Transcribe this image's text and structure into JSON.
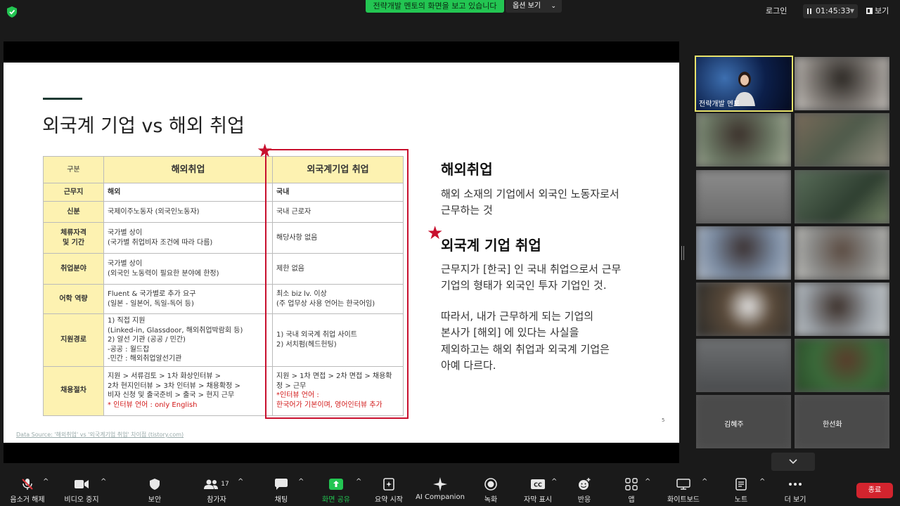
{
  "topbar": {
    "share_banner": "전략개발 멘토의 화면을 보고 있습니다",
    "view_options": "옵션 보기",
    "login": "로그인",
    "timer": "01:45:33",
    "view": "보기"
  },
  "slide": {
    "title": "외국계 기업 vs 해외 취업",
    "table": {
      "headers": [
        "구분",
        "해외취업",
        "외국계기업 취업"
      ],
      "rows": [
        {
          "cat": "근무지",
          "a": "해외",
          "b": "국내"
        },
        {
          "cat": "신분",
          "a": "국제이주노동자 (외국인노동자)",
          "b": "국내 근로자"
        },
        {
          "cat": "체류자격\n및 기간",
          "a": "국가별 상이\n(국가별 취업비자 조건에 따라 다름)",
          "b": "해당사항 없음"
        },
        {
          "cat": "취업분야",
          "a": "국가별 상이\n(외국인 노동력이 필요한 분야에 한정)",
          "b": "제한 없음"
        },
        {
          "cat": "어학 역량",
          "a": "Fluent & 국가별로 추가 요구\n(일본 - 일본어, 독일-독어 등)",
          "b": "최소 biz lv. 이상\n(주 업무상 사용 언어는 한국어임)"
        },
        {
          "cat": "지원경로",
          "a": "1) 직접 지원\n(Linked-in, Glassdoor, 해외취업박람회 등)\n2) 알선 기관 (공공 / 민간)\n-공공 : 월드잡\n-민간 : 해외취업알선기관",
          "b": "1) 국내 외국계 취업 사이트\n2) 서치펌(헤드헌팅)"
        },
        {
          "cat": "채용절차",
          "a": "지원 > 서류검토 > 1차 화상인터뷰 >\n2차 현지인터뷰 > 3차 인터뷰 > 채용확정 >\n비자 신청 및 출국준비 > 출국 > 현지 근무",
          "a_note": "* 인터뷰 언어 : only English",
          "b": "지원 > 1차 면접 > 2차 면접 > 채용확\n정 > 근무",
          "b_note": "*인터뷰 언어 :\n한국어가 기본이며, 영어인터뷰 추가"
        }
      ]
    },
    "sec1_title": "해외취업",
    "sec1_body": "해외 소재의 기업에서 외국인 노동자로서\n근무하는 것",
    "sec2_title": "외국계 기업 취업",
    "sec2_body": "근무지가 [한국] 인 국내 취업으로서 근무\n기업의 형태가 외국인 투자 기업인 것.",
    "sec3_body": "따라서, 내가 근무하게 되는 기업의\n본사가 [해외] 에 있다는 사실을\n제외하고는 해외 취업과 외국계 기업은\n아예 다르다.",
    "source": "Data Source: '해외취업' vs '외국계기업 취업' 차이점 (tistory.com)",
    "page_number": "5"
  },
  "participants": {
    "host_name": "전략개발 멘토",
    "others": [
      "",
      "",
      "",
      "",
      "",
      "",
      "",
      "",
      "",
      "",
      "",
      "",
      "김혜주",
      "한선화"
    ]
  },
  "toolbar": {
    "items": [
      {
        "label": "음소거 해제",
        "icon": "mic-off-icon"
      },
      {
        "label": "비디오 중지",
        "icon": "video-icon"
      },
      {
        "label": "보안",
        "icon": "shield-icon"
      },
      {
        "label": "참가자",
        "icon": "participants-icon",
        "count": "17"
      },
      {
        "label": "채팅",
        "icon": "chat-icon"
      },
      {
        "label": "화면 공유",
        "icon": "share-screen-icon"
      },
      {
        "label": "요약 시작",
        "icon": "summary-icon"
      },
      {
        "label": "AI Companion",
        "icon": "ai-sparkle-icon"
      },
      {
        "label": "녹화",
        "icon": "record-icon"
      },
      {
        "label": "자막 표시",
        "icon": "cc-icon"
      },
      {
        "label": "반응",
        "icon": "reaction-icon"
      },
      {
        "label": "앱",
        "icon": "apps-icon"
      },
      {
        "label": "화이트보드",
        "icon": "whiteboard-icon"
      },
      {
        "label": "노트",
        "icon": "notes-icon"
      },
      {
        "label": "더 보기",
        "icon": "more-icon"
      }
    ],
    "end": "종료"
  },
  "colors": {
    "accent_green": "#23c552",
    "end_red": "#d3242e",
    "table_header": "#fdf2b1",
    "highlight_red": "#c8102e"
  }
}
